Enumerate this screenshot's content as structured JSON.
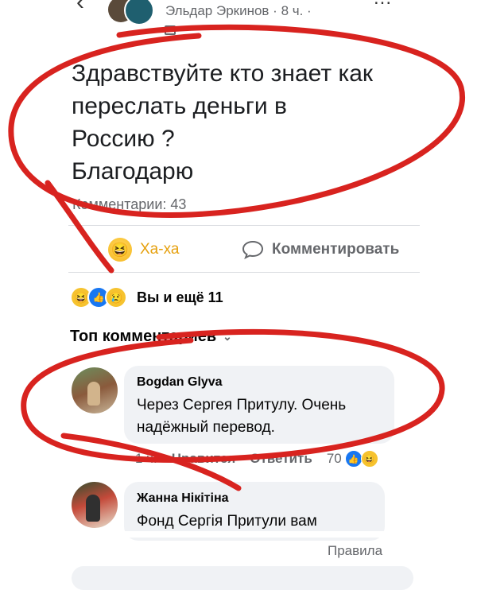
{
  "header": {
    "author": "Эльдар Эркинов · 8 ч. ·",
    "back_glyph": "‹",
    "more_glyph": "..."
  },
  "post": {
    "lines": [
      "Здравствуйте кто знает как",
      "переслать деньги в",
      "Россию ?",
      "Благодарю"
    ],
    "comments_count": "Комментарии: 43"
  },
  "actions": {
    "haha_label": "Ха-ха",
    "comment_label": "Комментировать"
  },
  "reactions": {
    "summary": "Вы и ещё 11",
    "icons": [
      "haha-icon",
      "like-icon",
      "sad-icon"
    ]
  },
  "top_comments": {
    "label": "Топ комментариев",
    "chevron": "⌄"
  },
  "comments": [
    {
      "author": "Bogdan Glyva",
      "text_lines": [
        "Через Сергея Притулу. Очень",
        "надёжный перевод."
      ],
      "time": "1 ч.",
      "like_label": "Нравится",
      "reply_label": "Ответить",
      "reaction_count": "70"
    },
    {
      "author": "Жанна Нікітіна",
      "text_lines": [
        "Фонд Сергія Притули вам"
      ]
    }
  ],
  "footer": {
    "rules_label": "Правила"
  },
  "colors": {
    "annotation_red": "#d8231f",
    "haha_yellow": "#f6c32f",
    "facebook_blue": "#1877f2",
    "secondary_text": "#65676b"
  }
}
